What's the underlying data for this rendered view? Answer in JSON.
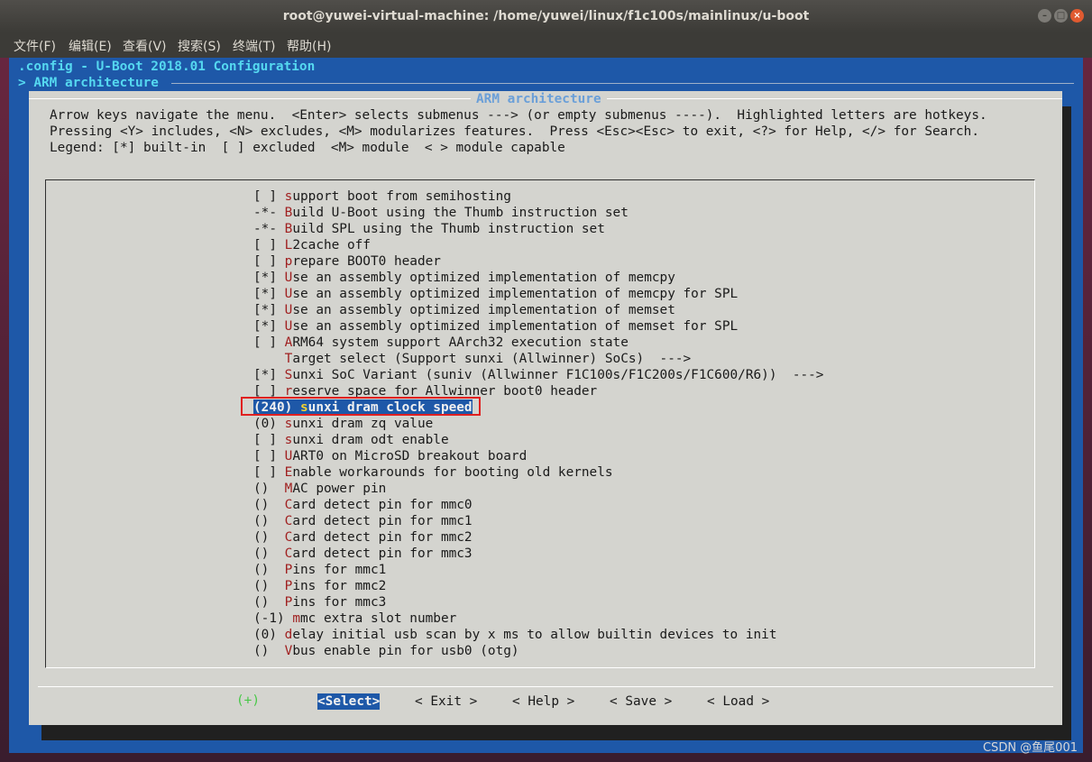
{
  "window": {
    "title": "root@yuwei-virtual-machine: /home/yuwei/linux/f1c100s/mainlinux/u-boot",
    "menu": [
      "文件(F)",
      "编辑(E)",
      "查看(V)",
      "搜索(S)",
      "终端(T)",
      "帮助(H)"
    ]
  },
  "header": {
    "config_line": ".config - U-Boot 2018.01 Configuration",
    "breadcrumb": "> ARM architecture"
  },
  "dialog": {
    "title": "ARM architecture",
    "help": [
      "Arrow keys navigate the menu.  <Enter> selects submenus ---> (or empty submenus ----).  Highlighted letters are hotkeys.",
      "Pressing <Y> includes, <N> excludes, <M> modularizes features.  Press <Esc><Esc> to exit, <?> for Help, </> for Search.",
      "Legend: [*] built-in  [ ] excluded  <M> module  < > module capable"
    ]
  },
  "items": [
    {
      "prefix": "[ ] ",
      "hk": "s",
      "rest": "upport boot from semihosting"
    },
    {
      "prefix": "-*- ",
      "hk": "B",
      "rest": "uild U-Boot using the Thumb instruction set"
    },
    {
      "prefix": "-*- ",
      "hk": "B",
      "rest": "uild SPL using the Thumb instruction set"
    },
    {
      "prefix": "[ ] ",
      "hk": "L",
      "rest": "2cache off"
    },
    {
      "prefix": "[ ] ",
      "hk": "p",
      "rest": "repare BOOT0 header"
    },
    {
      "prefix": "[*] ",
      "hk": "U",
      "rest": "se an assembly optimized implementation of memcpy"
    },
    {
      "prefix": "[*] ",
      "hk": "U",
      "rest": "se an assembly optimized implementation of memcpy for SPL"
    },
    {
      "prefix": "[*] ",
      "hk": "U",
      "rest": "se an assembly optimized implementation of memset"
    },
    {
      "prefix": "[*] ",
      "hk": "U",
      "rest": "se an assembly optimized implementation of memset for SPL"
    },
    {
      "prefix": "[ ] ",
      "hk": "A",
      "rest": "RM64 system support AArch32 execution state"
    },
    {
      "prefix": "    ",
      "hk": "T",
      "rest": "arget select (Support sunxi (Allwinner) SoCs)  --->"
    },
    {
      "prefix": "[*] ",
      "hk": "S",
      "rest": "unxi SoC Variant (suniv (Allwinner F1C100s/F1C200s/F1C600/R6))  --->"
    },
    {
      "prefix": "[ ] ",
      "hk": "r",
      "rest": "eserve space for Allwinner boot0 header"
    },
    {
      "prefix": "(240) ",
      "hk": "s",
      "rest": "unxi dram clock speed"
    },
    {
      "prefix": "(0) ",
      "hk": "s",
      "rest": "unxi dram zq value"
    },
    {
      "prefix": "[ ] ",
      "hk": "s",
      "rest": "unxi dram odt enable"
    },
    {
      "prefix": "[ ] ",
      "hk": "U",
      "rest": "ART0 on MicroSD breakout board"
    },
    {
      "prefix": "[ ] ",
      "hk": "E",
      "rest": "nable workarounds for booting old kernels"
    },
    {
      "prefix": "()  ",
      "hk": "M",
      "rest": "AC power pin"
    },
    {
      "prefix": "()  ",
      "hk": "C",
      "rest": "ard detect pin for mmc0"
    },
    {
      "prefix": "()  ",
      "hk": "C",
      "rest": "ard detect pin for mmc1"
    },
    {
      "prefix": "()  ",
      "hk": "C",
      "rest": "ard detect pin for mmc2"
    },
    {
      "prefix": "()  ",
      "hk": "C",
      "rest": "ard detect pin for mmc3"
    },
    {
      "prefix": "()  ",
      "hk": "P",
      "rest": "ins for mmc1"
    },
    {
      "prefix": "()  ",
      "hk": "P",
      "rest": "ins for mmc2"
    },
    {
      "prefix": "()  ",
      "hk": "P",
      "rest": "ins for mmc3"
    },
    {
      "prefix": "(-1) ",
      "hk": "m",
      "rest": "mc extra slot number"
    },
    {
      "prefix": "(0) ",
      "hk": "d",
      "rest": "elay initial usb scan by x ms to allow builtin devices to init"
    },
    {
      "prefix": "()  ",
      "hk": "V",
      "rest": "bus enable pin for usb0 (otg)"
    }
  ],
  "more_indicator": "(+)",
  "buttons": {
    "select": "<Select>",
    "exit": "< Exit >",
    "help": "< Help >",
    "save": "< Save >",
    "load": "< Load >"
  },
  "watermark": "CSDN @鱼尾001"
}
